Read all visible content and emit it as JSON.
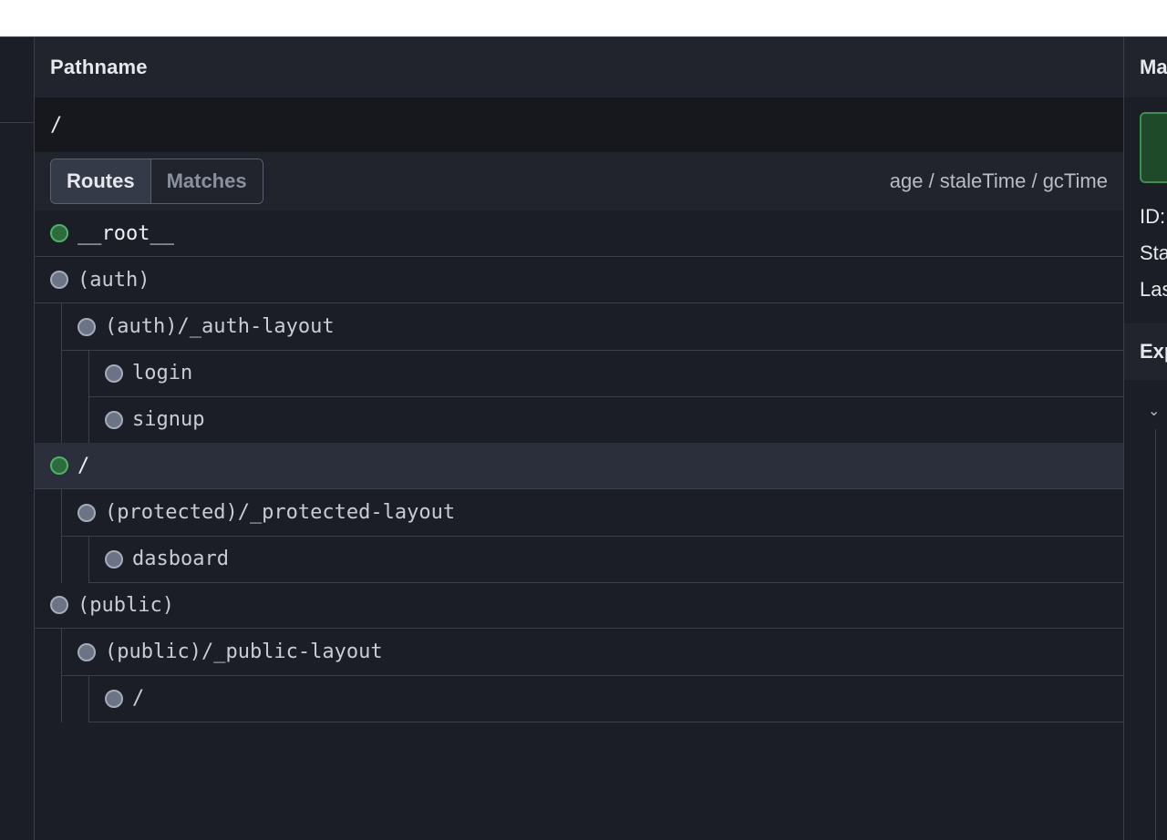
{
  "pathname_panel": {
    "title": "Pathname",
    "value": "/"
  },
  "tabs": [
    {
      "label": "Routes",
      "active": true
    },
    {
      "label": "Matches",
      "active": false
    }
  ],
  "age_label": "age / staleTime / gcTime",
  "routes": [
    {
      "label": "__root__",
      "status": "active",
      "depth": 0
    },
    {
      "label": "(auth)",
      "status": "idle",
      "depth": 0
    },
    {
      "label": "(auth)/_auth-layout",
      "status": "idle",
      "depth": 1
    },
    {
      "label": "login",
      "status": "idle",
      "depth": 2
    },
    {
      "label": "signup",
      "status": "idle",
      "depth": 2
    },
    {
      "label": "/",
      "status": "active",
      "depth": 0,
      "selected": true
    },
    {
      "label": "(protected)/_protected-layout",
      "status": "idle",
      "depth": 1
    },
    {
      "label": "dasboard",
      "status": "idle",
      "depth": 2
    },
    {
      "label": "(public)",
      "status": "idle",
      "depth": 0
    },
    {
      "label": "(public)/_public-layout",
      "status": "idle",
      "depth": 1
    },
    {
      "label": "/",
      "status": "idle",
      "depth": 2
    }
  ],
  "right_panel": {
    "header": "Ma",
    "id_label": "ID:",
    "state_label": "Sta",
    "last_label": "Las",
    "explorer_header": "Exp",
    "chevron": "⌄"
  },
  "colors": {
    "background": "#1b1e26",
    "header": "#21242d",
    "active_dot": "#4bb366",
    "idle_dot": "#6b7386"
  }
}
